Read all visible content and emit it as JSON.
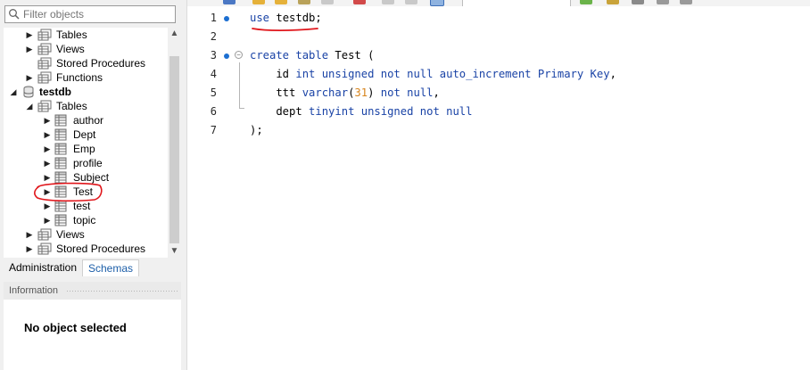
{
  "navigator": {
    "filter_placeholder": "Filter objects",
    "tree": [
      {
        "label": "Tables",
        "level": 2,
        "icon": "tables",
        "expanded": false,
        "bold": false
      },
      {
        "label": "Views",
        "level": 2,
        "icon": "tables",
        "expanded": false,
        "bold": false
      },
      {
        "label": "Stored Procedures",
        "level": 2,
        "icon": "tables",
        "expanded": null,
        "bold": false
      },
      {
        "label": "Functions",
        "level": 2,
        "icon": "tables",
        "expanded": false,
        "bold": false
      },
      {
        "label": "testdb",
        "level": 1,
        "icon": "database",
        "expanded": true,
        "bold": true
      },
      {
        "label": "Tables",
        "level": 2,
        "icon": "tables",
        "expanded": true,
        "bold": false
      },
      {
        "label": "author",
        "level": 3,
        "icon": "table",
        "expanded": false,
        "bold": false
      },
      {
        "label": "Dept",
        "level": 3,
        "icon": "table",
        "expanded": false,
        "bold": false
      },
      {
        "label": "Emp",
        "level": 3,
        "icon": "table",
        "expanded": false,
        "bold": false
      },
      {
        "label": "profile",
        "level": 3,
        "icon": "table",
        "expanded": false,
        "bold": false
      },
      {
        "label": "Subject",
        "level": 3,
        "icon": "table",
        "expanded": false,
        "bold": false
      },
      {
        "label": "Test",
        "level": 3,
        "icon": "table",
        "expanded": false,
        "bold": false
      },
      {
        "label": "test",
        "level": 3,
        "icon": "table",
        "expanded": false,
        "bold": false
      },
      {
        "label": "topic",
        "level": 3,
        "icon": "table",
        "expanded": false,
        "bold": false
      },
      {
        "label": "Views",
        "level": 2,
        "icon": "tables",
        "expanded": false,
        "bold": false
      },
      {
        "label": "Stored Procedures",
        "level": 2,
        "icon": "tables",
        "expanded": false,
        "bold": false
      }
    ],
    "tabs": {
      "administration": "Administration",
      "schemas": "Schemas"
    },
    "information_header": "Information",
    "information_message": "No object selected"
  },
  "editor": {
    "lines": [
      {
        "num": "1",
        "marker": true,
        "tokens": [
          {
            "t": "use",
            "c": "kw"
          },
          {
            "t": " testdb;",
            "c": ""
          }
        ]
      },
      {
        "num": "2",
        "marker": false,
        "tokens": []
      },
      {
        "num": "3",
        "marker": true,
        "fold": true,
        "tokens": [
          {
            "t": "create table",
            "c": "kw"
          },
          {
            "t": " Test (",
            "c": ""
          }
        ]
      },
      {
        "num": "4",
        "marker": false,
        "tokens": [
          {
            "t": "    id ",
            "c": ""
          },
          {
            "t": "int unsigned not null auto_increment Primary Key",
            "c": "kw"
          },
          {
            "t": ",",
            "c": ""
          }
        ]
      },
      {
        "num": "5",
        "marker": false,
        "tokens": [
          {
            "t": "    ttt ",
            "c": ""
          },
          {
            "t": "varchar",
            "c": "kw"
          },
          {
            "t": "(",
            "c": ""
          },
          {
            "t": "31",
            "c": "num"
          },
          {
            "t": ") ",
            "c": ""
          },
          {
            "t": "not null",
            "c": "kw"
          },
          {
            "t": ",",
            "c": ""
          }
        ]
      },
      {
        "num": "6",
        "marker": false,
        "tokens": [
          {
            "t": "    dept ",
            "c": ""
          },
          {
            "t": "tinyint unsigned not null",
            "c": "kw"
          }
        ]
      },
      {
        "num": "7",
        "marker": false,
        "tokens": [
          {
            "t": ");",
            "c": ""
          }
        ]
      }
    ]
  },
  "colors": {
    "keyword": "#1a43a6",
    "number": "#d8851d",
    "marker": "#1c6fd1",
    "annotation": "#e0161b"
  },
  "icons": {
    "search": "search-icon",
    "database": "database-icon",
    "tables": "tables-folder-icon",
    "table": "table-icon"
  }
}
